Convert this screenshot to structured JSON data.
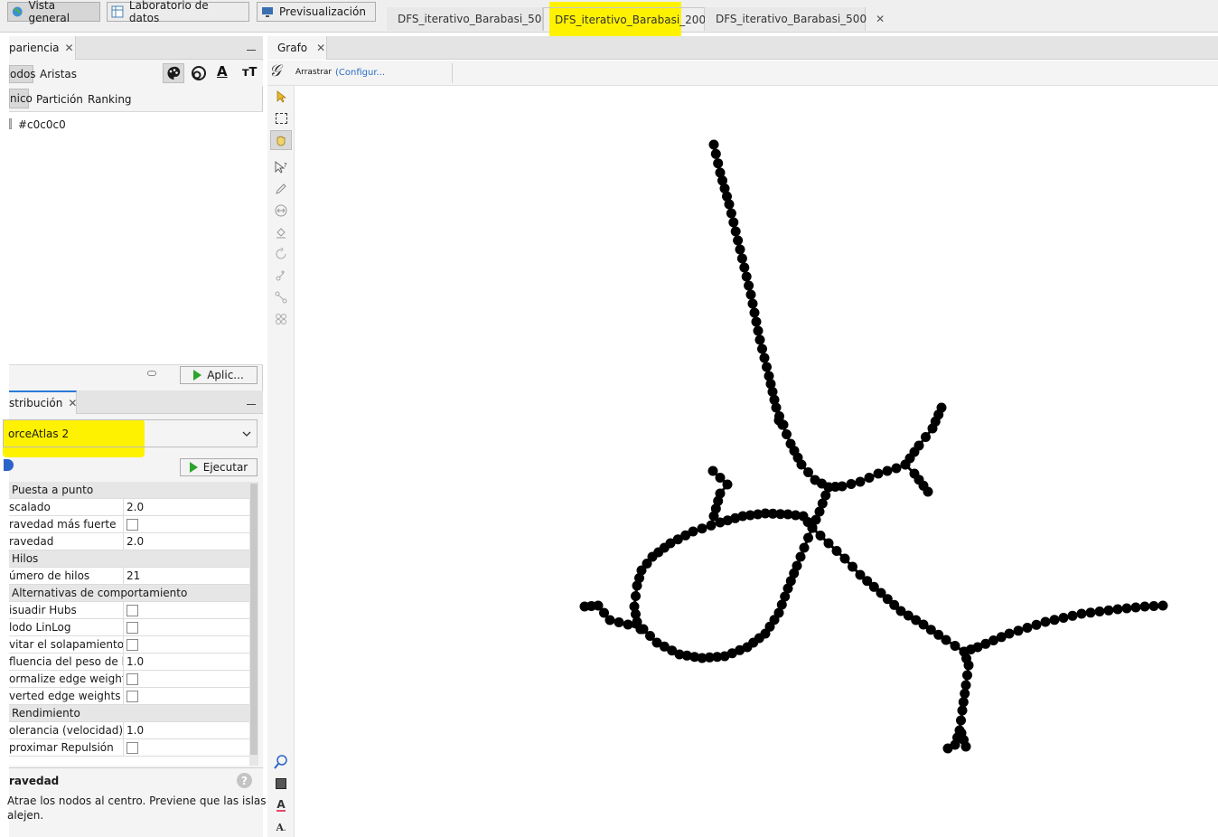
{
  "toolbar": {
    "overview": "Vista general",
    "data_lab": "Laboratorio de datos",
    "preview": "Previsualización"
  },
  "doc_tabs": [
    {
      "label": "DFS_iterativo_Barabasi_50"
    },
    {
      "label": "DFS_iterativo_Barabasi_200"
    },
    {
      "label": "DFS_iterativo_Barabasi_500"
    }
  ],
  "appearance": {
    "title": "pariencia",
    "tab_nodes": "odos",
    "tab_edges": "Aristas",
    "sub_unique": "nico",
    "sub_partition": "Partición",
    "sub_ranking": "Ranking",
    "color_value": "#c0c0c0",
    "apply_label": "Aplic..."
  },
  "layout": {
    "title": "stribución",
    "algorithm": "orceAtlas 2",
    "run_label": "Ejecutar"
  },
  "properties": [
    {
      "type": "category",
      "label": "Puesta a punto"
    },
    {
      "type": "text",
      "label": "scalado",
      "value": "2.0"
    },
    {
      "type": "check",
      "label": "ravedad más fuerte"
    },
    {
      "type": "text",
      "label": "ravedad",
      "value": "2.0"
    },
    {
      "type": "category",
      "label": "Hilos"
    },
    {
      "type": "text",
      "label": "úmero de hilos",
      "value": "21"
    },
    {
      "type": "category",
      "label": "Alternativas de comportamiento"
    },
    {
      "type": "check",
      "label": "isuadir Hubs"
    },
    {
      "type": "check",
      "label": "lodo LinLog"
    },
    {
      "type": "check",
      "label": "vitar el solapamiento"
    },
    {
      "type": "text",
      "label": "fluencia del peso de las",
      "value": "1.0"
    },
    {
      "type": "check",
      "label": "ormalize edge weights"
    },
    {
      "type": "check",
      "label": "verted edge weights"
    },
    {
      "type": "category",
      "label": "Rendimiento"
    },
    {
      "type": "text",
      "label": "olerancia (velocidad)",
      "value": "1.0"
    },
    {
      "type": "check",
      "label": "proximar Repulsión"
    }
  ],
  "description": {
    "title": "ravedad",
    "text_line1": "Atrae los nodos al centro. Previene que las islas se",
    "text_line2": "alejen."
  },
  "graph": {
    "tab_label": "Grafo",
    "drag_label": "Arrastrar",
    "configure_label": "(Configur..."
  },
  "colors": {
    "highlight": "#fff200",
    "node": "#000000",
    "play": "#2aa52a"
  }
}
